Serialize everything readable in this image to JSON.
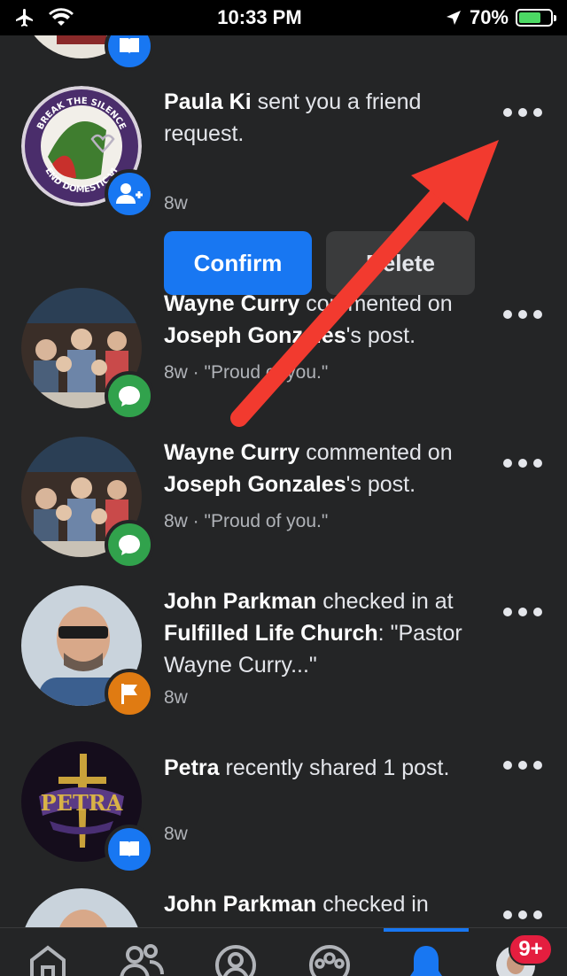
{
  "status_bar": {
    "time": "10:33 PM",
    "battery": "70%"
  },
  "notifications": [
    {
      "actor": "Paula Ki",
      "text": " sent you a friend request.",
      "time": "8w",
      "badge": "add-friend",
      "actions": {
        "confirm": "Confirm",
        "delete": "Delete"
      }
    },
    {
      "actor": "Wayne Curry",
      "text_1": " commented on ",
      "target": "Joseph Gonzales",
      "text_2": "'s post.",
      "time": "8w · \"Proud of you.\"",
      "badge": "comment"
    },
    {
      "actor": "Wayne Curry",
      "text_1": " commented on ",
      "target": "Joseph Gonzales",
      "text_2": "'s post.",
      "time": "8w · \"Proud of you.\"",
      "badge": "comment"
    },
    {
      "actor": "John Parkman",
      "text_1": " checked in at ",
      "target": "Fulfilled Life Church",
      "text_2": ": \"Pastor Wayne Curry...\"",
      "time": "8w",
      "badge": "flag"
    },
    {
      "actor": "Petra",
      "text": " recently shared 1 post.",
      "time": "8w",
      "badge": "book"
    },
    {
      "actor": "John Parkman",
      "text": " checked in",
      "badge": "flag"
    }
  ],
  "avatar_logo": {
    "top": "BREAK THE SILENCE",
    "bottom": "END DOMESTIC VI"
  },
  "tabs": [
    "home",
    "friends",
    "profile",
    "groups",
    "notifications",
    "menu"
  ],
  "active_tab": "notifications",
  "notification_count": "9+",
  "colors": {
    "background": "#242526",
    "accent": "#1877f2",
    "arrow": "#f23a2f",
    "badge_red": "#e41e3f"
  }
}
